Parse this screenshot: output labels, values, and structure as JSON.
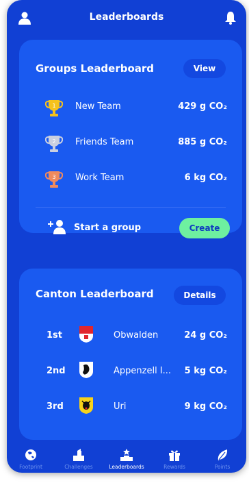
{
  "header": {
    "title": "Leaderboards"
  },
  "groups": {
    "title": "Groups Leaderboard",
    "view_label": "View",
    "items": [
      {
        "name": "New Team",
        "value": "429 g CO₂",
        "rank": "1",
        "trophy_color": "#f5c21d"
      },
      {
        "name": "Friends Team",
        "value": "885 g CO₂",
        "rank": "2",
        "trophy_color": "#c9cfe0"
      },
      {
        "name": "Work Team",
        "value": "6 kg CO₂",
        "rank": "3",
        "trophy_color": "#f08a5d"
      }
    ],
    "start_label": "Start a group",
    "create_label": "Create"
  },
  "canton": {
    "title": "Canton Leaderboard",
    "details_label": "Details",
    "items": [
      {
        "rank": "1st",
        "name": "Obwalden",
        "value": "24 g CO₂",
        "crest": "obwalden-crest"
      },
      {
        "rank": "2nd",
        "name": "Appenzell I...",
        "value": "5 kg CO₂",
        "crest": "appenzell-crest"
      },
      {
        "rank": "3rd",
        "name": "Uri",
        "value": "9 kg CO₂",
        "crest": "uri-crest"
      }
    ]
  },
  "tabs": [
    {
      "label": "Footprint",
      "icon": "globe-icon"
    },
    {
      "label": "Challenges",
      "icon": "challenges-icon"
    },
    {
      "label": "Leaderboards",
      "icon": "podium-icon",
      "active": true
    },
    {
      "label": "Rewards",
      "icon": "gift-icon"
    },
    {
      "label": "Points",
      "icon": "leaf-icon"
    }
  ],
  "colors": {
    "background": "#1140d4",
    "card": "#1a5af0",
    "create_button": "#6ef0a0"
  }
}
